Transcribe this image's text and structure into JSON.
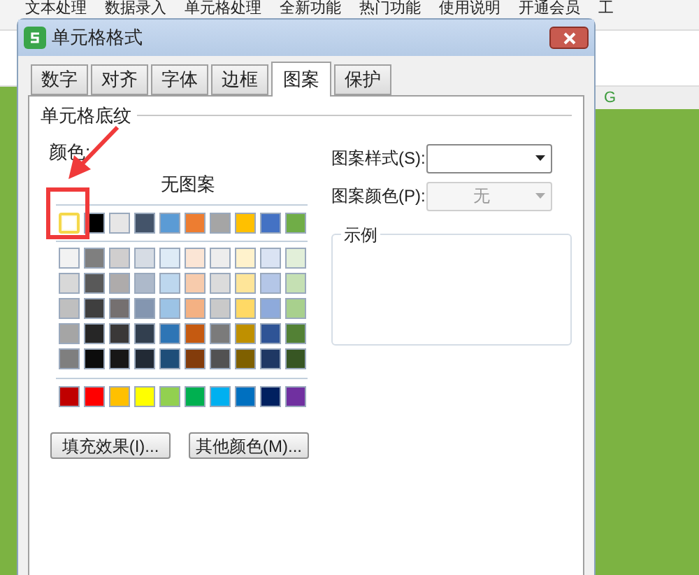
{
  "app_menu": [
    "文本处理",
    "数据录入",
    "单元格处理",
    "全新功能",
    "热门功能",
    "使用说明",
    "开通会员",
    "工"
  ],
  "sheet": {
    "column_header": "G"
  },
  "dialog": {
    "title": "单元格格式",
    "tabs": [
      {
        "label": "数字",
        "selected": false
      },
      {
        "label": "对齐",
        "selected": false
      },
      {
        "label": "字体",
        "selected": false
      },
      {
        "label": "边框",
        "selected": false
      },
      {
        "label": "图案",
        "selected": true
      },
      {
        "label": "保护",
        "selected": false
      }
    ],
    "group_title": "单元格底纹",
    "color_label": "颜色:",
    "no_pattern": "无图案",
    "theme_colors": [
      {
        "color": "#ffffff",
        "selected": true
      },
      {
        "color": "#000000",
        "selected": false
      },
      {
        "color": "#e7e6e6",
        "selected": false
      },
      {
        "color": "#44546a",
        "selected": false
      },
      {
        "color": "#5b9bd5",
        "selected": false
      },
      {
        "color": "#ed7d31",
        "selected": false
      },
      {
        "color": "#a5a5a5",
        "selected": false
      },
      {
        "color": "#ffc000",
        "selected": false
      },
      {
        "color": "#4472c4",
        "selected": false
      },
      {
        "color": "#70ad47",
        "selected": false
      }
    ],
    "shade_rows": [
      [
        {
          "color": "#f2f2f2",
          "selected": false
        },
        {
          "color": "#7f7f7f",
          "selected": false
        },
        {
          "color": "#d0cece",
          "selected": false
        },
        {
          "color": "#d6dce4",
          "selected": false
        },
        {
          "color": "#deebf6",
          "selected": false
        },
        {
          "color": "#fbe5d5",
          "selected": false
        },
        {
          "color": "#ededed",
          "selected": false
        },
        {
          "color": "#fff2cc",
          "selected": false
        },
        {
          "color": "#dae3f3",
          "selected": false
        },
        {
          "color": "#e2efd9",
          "selected": false
        }
      ],
      [
        {
          "color": "#d8d8d8",
          "selected": false
        },
        {
          "color": "#595959",
          "selected": false
        },
        {
          "color": "#aeabab",
          "selected": false
        },
        {
          "color": "#adb9ca",
          "selected": false
        },
        {
          "color": "#bdd7ee",
          "selected": false
        },
        {
          "color": "#f7cbac",
          "selected": false
        },
        {
          "color": "#dbdbdb",
          "selected": false
        },
        {
          "color": "#fee599",
          "selected": false
        },
        {
          "color": "#b4c6e7",
          "selected": false
        },
        {
          "color": "#c5e0b3",
          "selected": false
        }
      ],
      [
        {
          "color": "#bfbfbf",
          "selected": false
        },
        {
          "color": "#3f3f3f",
          "selected": false
        },
        {
          "color": "#757070",
          "selected": false
        },
        {
          "color": "#8496b0",
          "selected": false
        },
        {
          "color": "#9cc3e5",
          "selected": false
        },
        {
          "color": "#f4b183",
          "selected": false
        },
        {
          "color": "#c9c9c9",
          "selected": false
        },
        {
          "color": "#ffd965",
          "selected": false
        },
        {
          "color": "#8eaadb",
          "selected": false
        },
        {
          "color": "#a8d08d",
          "selected": false
        }
      ],
      [
        {
          "color": "#a5a5a5",
          "selected": false
        },
        {
          "color": "#262626",
          "selected": false
        },
        {
          "color": "#3a3838",
          "selected": false
        },
        {
          "color": "#323f4f",
          "selected": false
        },
        {
          "color": "#2e75b5",
          "selected": false
        },
        {
          "color": "#c55a11",
          "selected": false
        },
        {
          "color": "#7b7b7b",
          "selected": false
        },
        {
          "color": "#bf9000",
          "selected": false
        },
        {
          "color": "#2f5496",
          "selected": false
        },
        {
          "color": "#538135",
          "selected": false
        }
      ],
      [
        {
          "color": "#7f7f7f",
          "selected": false
        },
        {
          "color": "#0c0c0c",
          "selected": false
        },
        {
          "color": "#171616",
          "selected": false
        },
        {
          "color": "#222a35",
          "selected": false
        },
        {
          "color": "#1e4e79",
          "selected": false
        },
        {
          "color": "#833c0b",
          "selected": false
        },
        {
          "color": "#525252",
          "selected": false
        },
        {
          "color": "#7f6000",
          "selected": false
        },
        {
          "color": "#1f3864",
          "selected": false
        },
        {
          "color": "#375623",
          "selected": false
        }
      ]
    ],
    "standard_colors": [
      {
        "color": "#c00000",
        "selected": false
      },
      {
        "color": "#ff0000",
        "selected": false
      },
      {
        "color": "#ffc000",
        "selected": false
      },
      {
        "color": "#ffff00",
        "selected": false
      },
      {
        "color": "#92d050",
        "selected": false
      },
      {
        "color": "#00b050",
        "selected": false
      },
      {
        "color": "#00b0f0",
        "selected": false
      },
      {
        "color": "#0070c0",
        "selected": false
      },
      {
        "color": "#002060",
        "selected": false
      },
      {
        "color": "#7030a0",
        "selected": false
      }
    ],
    "pattern_style": {
      "label": "图案样式(S):"
    },
    "pattern_color": {
      "label": "图案颜色(P):",
      "value": "无",
      "disabled": true
    },
    "sample_title": "示例",
    "buttons": [
      "填充效果(I)...",
      "其他颜色(M)..."
    ]
  }
}
